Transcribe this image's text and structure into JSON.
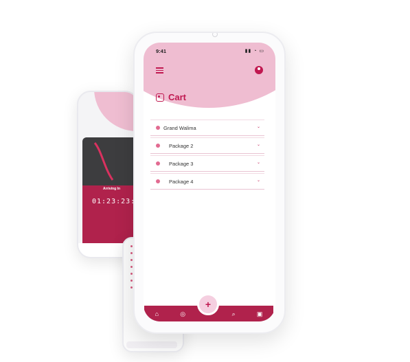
{
  "back_phone": {
    "arriving_label": "Arriving In",
    "timer": "01:23:23:0",
    "fab_label": "+"
  },
  "main_phone": {
    "status": {
      "time": "9:41",
      "icons": "▮▮ ◔ ▭"
    },
    "title": "Cart",
    "packages": [
      {
        "label": "Grand Walima"
      },
      {
        "label": "Package 2"
      },
      {
        "label": "Package 3"
      },
      {
        "label": "Package 4"
      }
    ],
    "nav": [
      "⌂",
      "◎",
      "+",
      "⌕",
      "▣"
    ],
    "fab_label": "+",
    "colors": {
      "accent": "#c01850",
      "pink": "#efbdd1",
      "nav": "#b0224c"
    }
  }
}
